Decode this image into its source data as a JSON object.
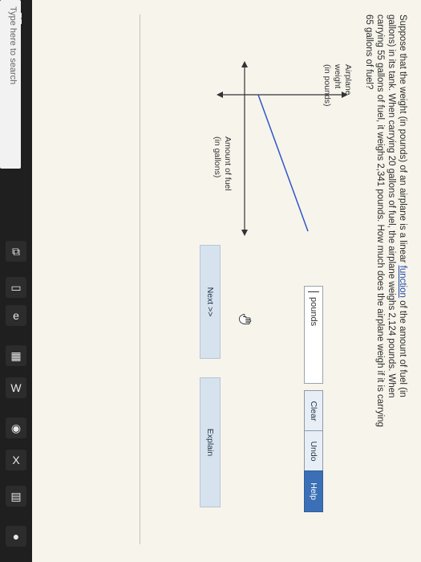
{
  "taskbar": {
    "search_placeholder": "Type here to search"
  },
  "problem": {
    "text_part1": "Suppose that the weight (in pounds) of an airplane is a linear ",
    "link_text": "function",
    "text_part2": " of the amount of fuel (in gallons) in its tank. When carrying 20 gallons of fuel, the airplane weighs 2,124 pounds. When carrying 55 gallons of fuel, it weighs 2,341 pounds. How much does the airplane weigh if it is carrying 65 gallons of fuel?"
  },
  "graph": {
    "y_label_line1": "Airplane",
    "y_label_line2": "weight",
    "y_label_line3": "(in pounds)",
    "x_label_line1": "Amount of fuel",
    "x_label_line2": "(in gallons)"
  },
  "answer": {
    "unit": "pounds",
    "value": ""
  },
  "buttons": {
    "clear": "Clear",
    "undo": "Undo",
    "help": "Help",
    "next": "Next >>",
    "explain": "Explain"
  },
  "colors": {
    "accent_blue": "#3b6fb6",
    "line_blue": "#2f57c7"
  },
  "icons": {
    "start": "windows-start-icon",
    "search": "search-icon",
    "taskview": "task-view-icon",
    "folder": "folder-icon",
    "edge": "edge-icon",
    "store": "store-icon",
    "word": "word-icon",
    "chrome": "chrome-icon",
    "excel": "excel-icon",
    "calculator": "calculator-icon",
    "spotify": "spotify-icon",
    "hand_cursor": "hand-cursor-icon"
  }
}
